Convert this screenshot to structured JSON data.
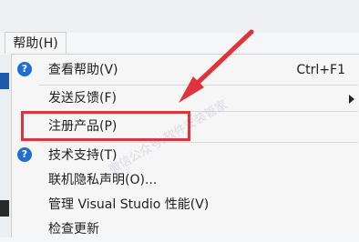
{
  "menu_bar": {
    "help_menu_label": "帮助(H)"
  },
  "help_menu": {
    "items": [
      {
        "label": "查看帮助(V)",
        "shortcut": "Ctrl+F1",
        "icon": "help-icon"
      },
      {
        "label": "发送反馈(F)",
        "has_submenu": true
      },
      {
        "label": "注册产品(P)",
        "highlighted": true
      },
      {
        "label": "技术支持(T)",
        "icon": "help-icon"
      },
      {
        "label": "联机隐私声明(O)..."
      },
      {
        "label": "管理 Visual Studio 性能(V)"
      },
      {
        "label": "检查更新"
      }
    ],
    "help_icon_glyph": "?"
  },
  "annotation": {
    "color": "#e0333a"
  },
  "watermark_text": "微信公众号:软件安装管家"
}
